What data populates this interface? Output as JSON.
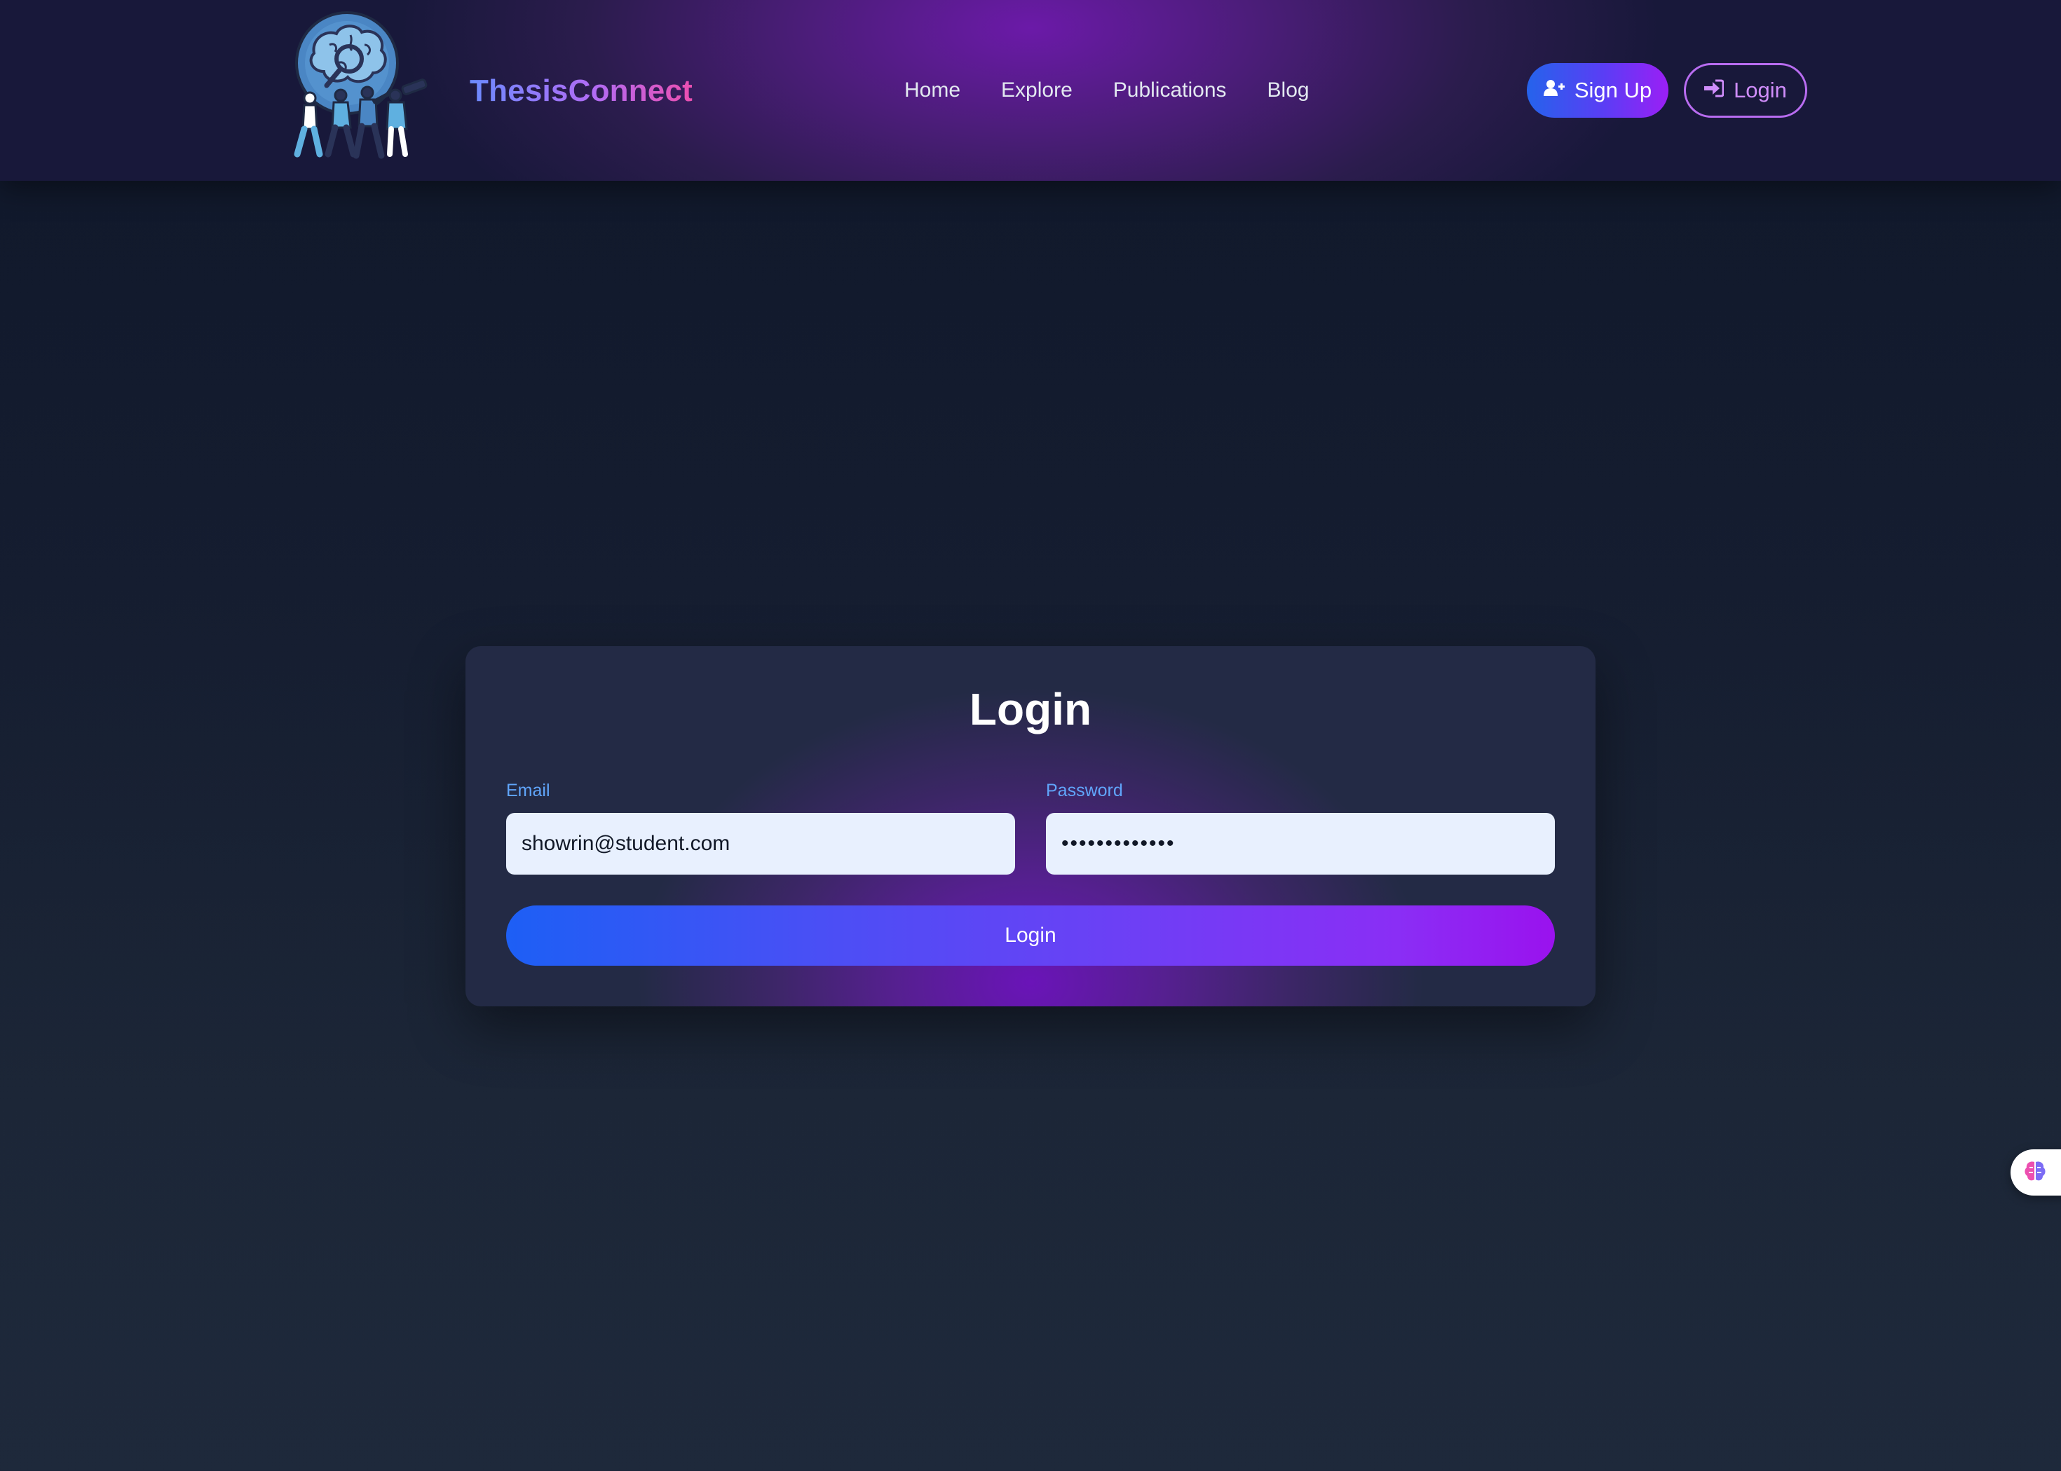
{
  "header": {
    "brand": "ThesisConnect",
    "nav": [
      {
        "label": "Home"
      },
      {
        "label": "Explore"
      },
      {
        "label": "Publications"
      },
      {
        "label": "Blog"
      }
    ],
    "signup_label": "Sign Up",
    "login_label": "Login",
    "logo_icon": "brain-research-team-logo",
    "signup_icon": "user-plus-icon",
    "login_icon": "sign-in-icon"
  },
  "login_form": {
    "title": "Login",
    "email_label": "Email",
    "email_value": "showrin@student.com",
    "password_label": "Password",
    "password_value": "•••••••••••••",
    "submit_label": "Login"
  },
  "widget": {
    "icon": "brain-icon"
  },
  "colors": {
    "accent_blue": "#2563eb",
    "accent_purple": "#9b1ff5",
    "label_blue": "#60a5fa",
    "page_background": "#0f172a"
  }
}
